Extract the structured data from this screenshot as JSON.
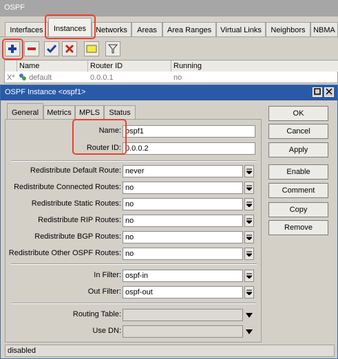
{
  "window": {
    "title": "OSPF"
  },
  "tabs": [
    "Interfaces",
    "Instances",
    "Networks",
    "Areas",
    "Area Ranges",
    "Virtual Links",
    "Neighbors",
    "NBMA"
  ],
  "toolbar": {
    "icons": [
      "add-icon",
      "remove-icon",
      "enable-icon",
      "disable-icon",
      "comment-icon",
      "filter-icon"
    ]
  },
  "list": {
    "columns": [
      "Name",
      "Router ID",
      "Running"
    ],
    "rows": [
      {
        "flags": "X*",
        "name": "default",
        "router_id": "0.0.0.1",
        "running": "no"
      }
    ]
  },
  "dialog": {
    "title": "OSPF Instance <ospf1>",
    "tabs": [
      "General",
      "Metrics",
      "MPLS",
      "Status"
    ],
    "fields": {
      "name": {
        "label": "Name:",
        "value": "ospf1"
      },
      "router_id": {
        "label": "Router ID:",
        "value": "0.0.0.2"
      },
      "redistribute": [
        {
          "label": "Redistribute Default Route:",
          "value": "never"
        },
        {
          "label": "Redistribute Connected Routes:",
          "value": "no"
        },
        {
          "label": "Redistribute Static Routes:",
          "value": "no"
        },
        {
          "label": "Redistribute RIP Routes:",
          "value": "no"
        },
        {
          "label": "Redistribute BGP Routes:",
          "value": "no"
        },
        {
          "label": "Redistribute Other OSPF Routes:",
          "value": "no"
        }
      ],
      "in_filter": {
        "label": "In Filter:",
        "value": "ospf-in"
      },
      "out_filter": {
        "label": "Out Filter:",
        "value": "ospf-out"
      },
      "routing_table": {
        "label": "Routing Table:",
        "value": ""
      },
      "use_dn": {
        "label": "Use DN:",
        "value": ""
      }
    },
    "buttons": [
      "OK",
      "Cancel",
      "Apply",
      "Enable",
      "Comment",
      "Copy",
      "Remove"
    ],
    "status": "disabled"
  },
  "colors": {
    "highlight": "#e8422f",
    "dialog_title": "#2a5aa7",
    "add": "#1a3d9c",
    "remove": "#c0281f"
  }
}
